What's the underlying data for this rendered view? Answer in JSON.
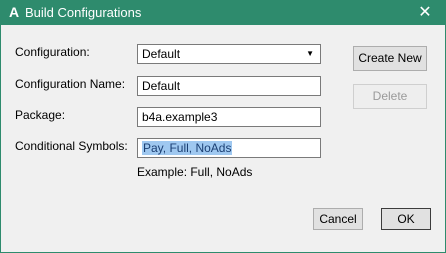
{
  "window": {
    "title": "Build Configurations",
    "app_icon_glyph": "A",
    "close_glyph": "✕",
    "accent_color": "#2e8b6d"
  },
  "form": {
    "configuration": {
      "label": "Configuration:",
      "value": "Default",
      "arrow": "▼"
    },
    "configuration_name": {
      "label": "Configuration Name:",
      "value": "Default"
    },
    "package": {
      "label": "Package:",
      "value": "b4a.example3"
    },
    "conditional_symbols": {
      "label": "Conditional Symbols:",
      "value": "Pay, Full, NoAds"
    },
    "example_hint": "Example: Full, NoAds"
  },
  "buttons": {
    "create_new": "Create New",
    "delete": "Delete",
    "cancel": "Cancel",
    "ok": "OK"
  }
}
